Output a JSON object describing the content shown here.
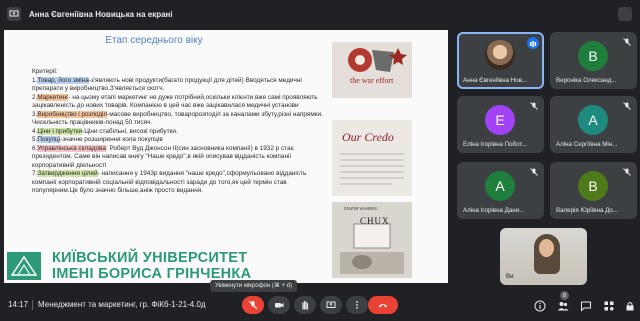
{
  "header": {
    "title": "Анна Євгеніївна Новицька на екрані"
  },
  "slide": {
    "title": "Етап середнього віку",
    "criteria_label": "Критерії:",
    "items": [
      {
        "num": "1.",
        "hl": "Товар, його зміна",
        "rest": "-з'являють нові продукти(багато продукції для дітей) Вводяться медичні препарати у виробництво.З'являється скотч."
      },
      {
        "num": "2.",
        "hl": "Маркетинг",
        "rest": "- на цьому етапі маркетинг не дуже потрібний,оскільки клієнти вже самі проявляють зацікавленість до нових товарів. Компанією в цей час вже зацікавилася медичні установи"
      },
      {
        "num": "3.",
        "hl": "Виробництво і розподіл",
        "rest": "-масове виробництво, товаророзподіл за каналами збуту,різні напрямки. Чисельність працівників-понад 50 тисяч."
      },
      {
        "num": "4.",
        "hl": "Ціни і прибутки",
        "rest": "-Ціни стабільні, високі прибутки."
      },
      {
        "num": "5.",
        "hl": "Покупці",
        "rest": "-значне розширення кола покупців"
      },
      {
        "num": "6.",
        "hl": "Управлінська складова",
        "rest": ": Роберт Вуд Джонсон II(син засновника компанії) в 1932 р стає президентом. Саме він написав книгу \"Наше кредо\",в якій описував відданість компанії корпоративній діяльності"
      },
      {
        "num": "7.",
        "hl": "Затвердження цілей",
        "rest": "- написання у 1943р видання \"наше кредо\",сформульовано відданість компанії корпоративній соціальній відповідальності заради до того,як цей термін став популярним.Це було значно більше,аніж просто видання."
      }
    ],
    "image1_caption": "the war effort",
    "image2_caption": "Our Credo",
    "image3_top": "DIAPER WASHING",
    "image3_caption": "CHUX",
    "university_line1": "КИЇВСЬКИЙ УНІВЕРСИТЕТ",
    "university_line2": "ІМЕНІ БОРИСА ГРІНЧЕНКА"
  },
  "participants": [
    {
      "initial": "",
      "name": "Анна Євгеніївна Нов...",
      "color": "#3c4043"
    },
    {
      "initial": "В",
      "name": "Вероніка Олександ...",
      "color": "#1e7f3c"
    },
    {
      "initial": "Е",
      "name": "Еліна Ігорівна Побот...",
      "color": "#a142f4"
    },
    {
      "initial": "А",
      "name": "Аліна Сергіївна Мін...",
      "color": "#1e8a80"
    },
    {
      "initial": "А",
      "name": "Аліна Ігорівна Дани...",
      "color": "#1e7f3c"
    },
    {
      "initial": "В",
      "name": "Валерія Юріївна До...",
      "color": "#4e7a1c"
    }
  ],
  "self_view": {
    "name": "Ви"
  },
  "footer": {
    "time": "14:17",
    "meeting_name": "Менеджмент та маркетинг, гр. ФіКб-1-21-4.0д",
    "mic_tooltip": "Увімкнути мікрофон (⌘ + d)",
    "people_count": "8"
  },
  "colors": {
    "background": "#202124",
    "tile": "#3c4043",
    "danger": "#ea4335",
    "accent": "#1a73e8",
    "university_green": "#2c9a78"
  }
}
